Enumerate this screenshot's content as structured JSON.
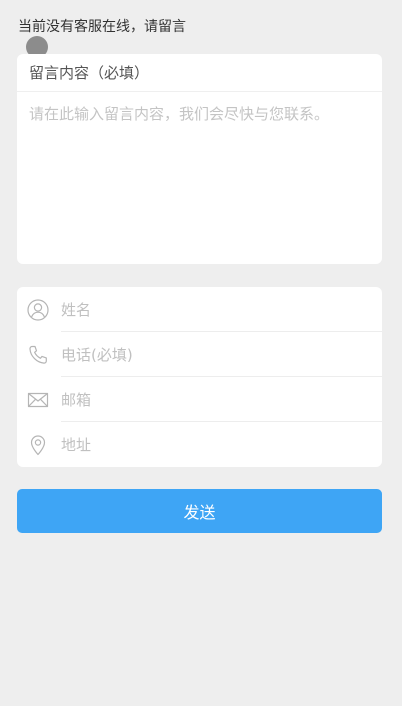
{
  "notice": {
    "text": "当前没有客服在线，请留言"
  },
  "message": {
    "title": "留言内容（必填）",
    "placeholder": "请在此输入留言内容，我们会尽快与您联系。",
    "value": ""
  },
  "contact": {
    "fields": [
      {
        "icon": "user-icon",
        "placeholder": "姓名",
        "value": ""
      },
      {
        "icon": "phone-icon",
        "placeholder": "电话(必填)",
        "value": ""
      },
      {
        "icon": "mail-icon",
        "placeholder": "邮箱",
        "value": ""
      },
      {
        "icon": "location-icon",
        "placeholder": "地址",
        "value": ""
      }
    ]
  },
  "send_button": {
    "label": "发送"
  },
  "colors": {
    "background": "#eeeeee",
    "card": "#ffffff",
    "primary": "#3ea5f5",
    "placeholder": "#c0c0c0",
    "icon": "#b5b5b5"
  }
}
